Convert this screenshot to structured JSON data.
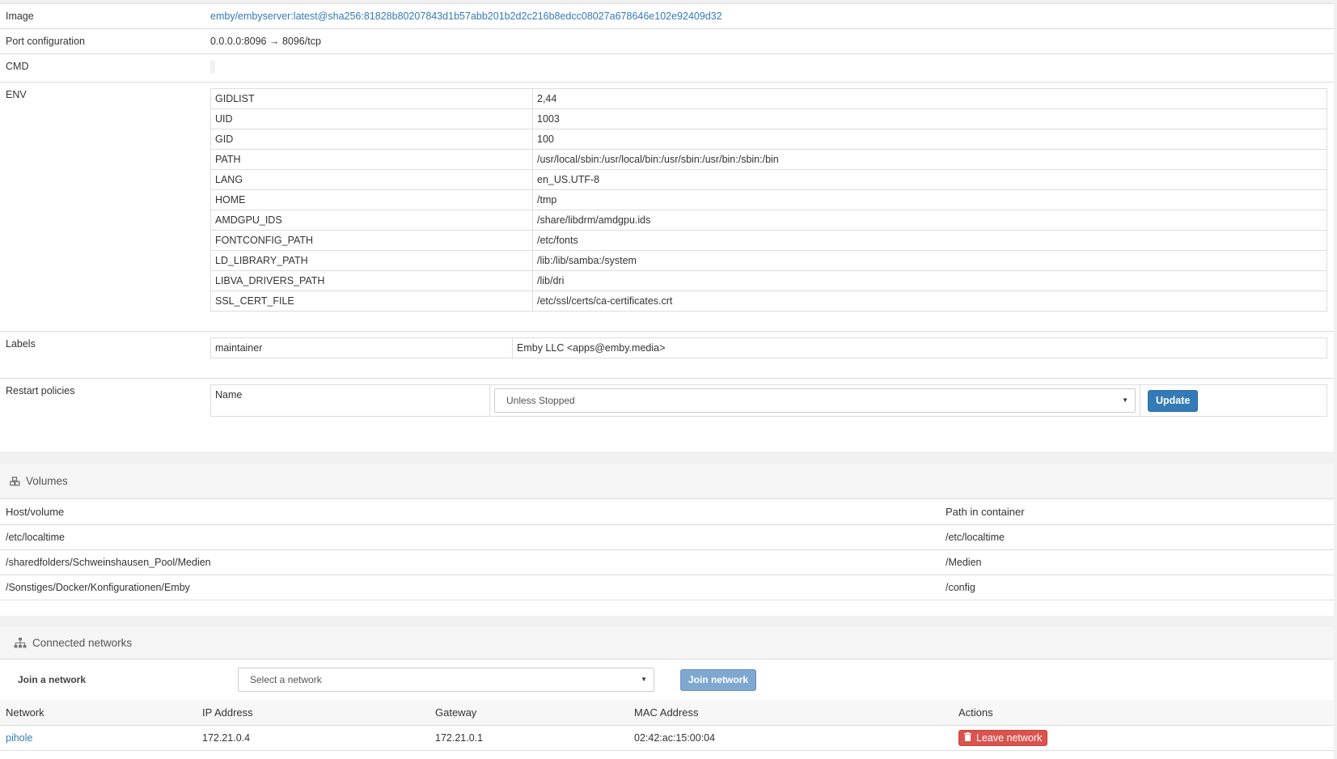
{
  "details": {
    "image": {
      "label": "Image",
      "value": "emby/embyserver:latest@sha256:81828b80207843d1b57abb201b2d2c216b8edcc08027a678646e102e92409d32"
    },
    "ports": {
      "label": "Port configuration",
      "value": "0.0.0.0:8096 → 8096/tcp"
    },
    "cmd": {
      "label": "CMD"
    },
    "env": {
      "label": "ENV",
      "rows": [
        {
          "key": "GIDLIST",
          "value": "2,44"
        },
        {
          "key": "UID",
          "value": "1003"
        },
        {
          "key": "GID",
          "value": "100"
        },
        {
          "key": "PATH",
          "value": "/usr/local/sbin:/usr/local/bin:/usr/sbin:/usr/bin:/sbin:/bin"
        },
        {
          "key": "LANG",
          "value": "en_US.UTF-8"
        },
        {
          "key": "HOME",
          "value": "/tmp"
        },
        {
          "key": "AMDGPU_IDS",
          "value": "/share/libdrm/amdgpu.ids"
        },
        {
          "key": "FONTCONFIG_PATH",
          "value": "/etc/fonts"
        },
        {
          "key": "LD_LIBRARY_PATH",
          "value": "/lib:/lib/samba:/system"
        },
        {
          "key": "LIBVA_DRIVERS_PATH",
          "value": "/lib/dri"
        },
        {
          "key": "SSL_CERT_FILE",
          "value": "/etc/ssl/certs/ca-certificates.crt"
        }
      ]
    },
    "labels": {
      "label": "Labels",
      "rows": [
        {
          "key": "maintainer",
          "value": "Emby LLC <apps@emby.media>"
        }
      ]
    },
    "restart": {
      "label": "Restart policies",
      "name_label": "Name",
      "selected": "Unless Stopped",
      "update_label": "Update"
    }
  },
  "volumes": {
    "title": "Volumes",
    "headers": {
      "host": "Host/volume",
      "container": "Path in container"
    },
    "rows": [
      {
        "host": "/etc/localtime",
        "container": "/etc/localtime"
      },
      {
        "host": "/sharedfolders/Schweinshausen_Pool/Medien",
        "container": "/Medien"
      },
      {
        "host": "/Sonstiges/Docker/Konfigurationen/Emby",
        "container": "/config"
      }
    ]
  },
  "networks": {
    "title": "Connected networks",
    "join_label": "Join a network",
    "select_placeholder": "Select a network",
    "join_button": "Join network",
    "headers": {
      "network": "Network",
      "ip": "IP Address",
      "gateway": "Gateway",
      "mac": "MAC Address",
      "actions": "Actions"
    },
    "rows": [
      {
        "network": "pihole",
        "ip": "172.21.0.4",
        "gateway": "172.21.0.1",
        "mac": "02:42:ac:15:00:04",
        "action": "Leave network"
      }
    ]
  },
  "colors": {
    "primary": "#337ab7",
    "danger": "#d9534f",
    "link": "#337ab7"
  },
  "icons": {
    "volumes": "cubes-icon",
    "networks": "sitemap-icon",
    "leave": "trash-icon",
    "select": "chevron-down-icon"
  }
}
